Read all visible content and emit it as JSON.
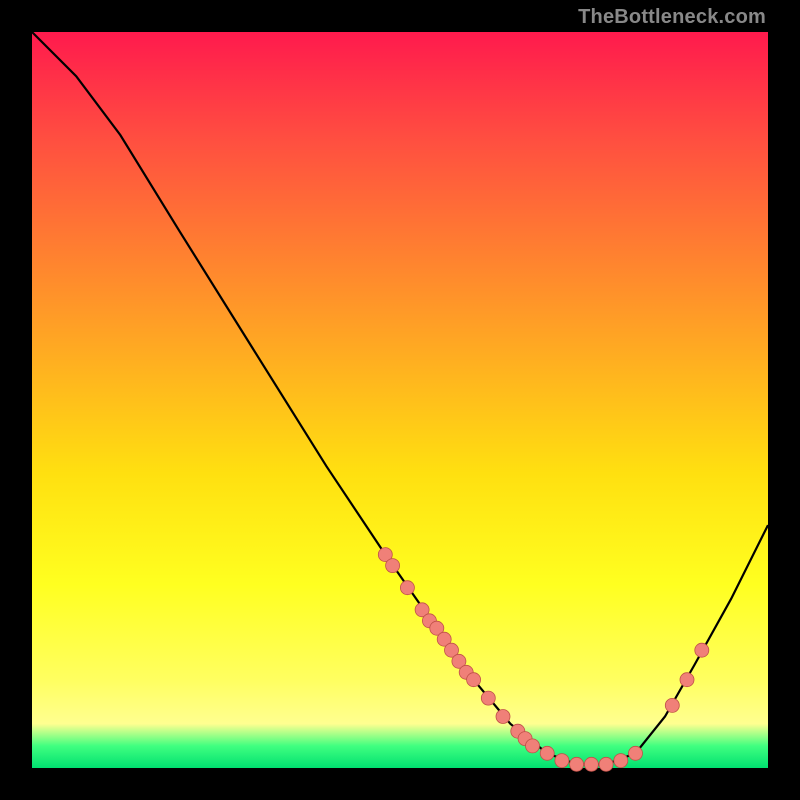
{
  "watermark": "TheBottleneck.com",
  "colors": {
    "curve_stroke": "#000000",
    "point_fill": "#f08078",
    "point_stroke": "#c05048"
  },
  "chart_data": {
    "type": "line",
    "title": "",
    "xlabel": "",
    "ylabel": "",
    "xlim": [
      0,
      100
    ],
    "ylim": [
      0,
      100
    ],
    "curve": [
      {
        "x": 0,
        "y": 100
      },
      {
        "x": 6,
        "y": 94
      },
      {
        "x": 12,
        "y": 86
      },
      {
        "x": 20,
        "y": 73
      },
      {
        "x": 30,
        "y": 57
      },
      {
        "x": 40,
        "y": 41
      },
      {
        "x": 48,
        "y": 29
      },
      {
        "x": 55,
        "y": 19
      },
      {
        "x": 60,
        "y": 12
      },
      {
        "x": 65,
        "y": 6
      },
      {
        "x": 70,
        "y": 2
      },
      {
        "x": 74,
        "y": 0.5
      },
      {
        "x": 78,
        "y": 0.5
      },
      {
        "x": 82,
        "y": 2
      },
      {
        "x": 86,
        "y": 7
      },
      {
        "x": 90,
        "y": 14
      },
      {
        "x": 95,
        "y": 23
      },
      {
        "x": 100,
        "y": 33
      }
    ],
    "points": [
      {
        "x": 48,
        "y": 29
      },
      {
        "x": 49,
        "y": 27.5
      },
      {
        "x": 51,
        "y": 24.5
      },
      {
        "x": 53,
        "y": 21.5
      },
      {
        "x": 54,
        "y": 20
      },
      {
        "x": 55,
        "y": 19
      },
      {
        "x": 56,
        "y": 17.5
      },
      {
        "x": 57,
        "y": 16
      },
      {
        "x": 58,
        "y": 14.5
      },
      {
        "x": 59,
        "y": 13
      },
      {
        "x": 60,
        "y": 12
      },
      {
        "x": 62,
        "y": 9.5
      },
      {
        "x": 64,
        "y": 7
      },
      {
        "x": 66,
        "y": 5
      },
      {
        "x": 67,
        "y": 4
      },
      {
        "x": 68,
        "y": 3
      },
      {
        "x": 70,
        "y": 2
      },
      {
        "x": 72,
        "y": 1
      },
      {
        "x": 74,
        "y": 0.5
      },
      {
        "x": 76,
        "y": 0.5
      },
      {
        "x": 78,
        "y": 0.5
      },
      {
        "x": 80,
        "y": 1
      },
      {
        "x": 82,
        "y": 2
      },
      {
        "x": 87,
        "y": 8.5
      },
      {
        "x": 89,
        "y": 12
      },
      {
        "x": 91,
        "y": 16
      }
    ]
  }
}
